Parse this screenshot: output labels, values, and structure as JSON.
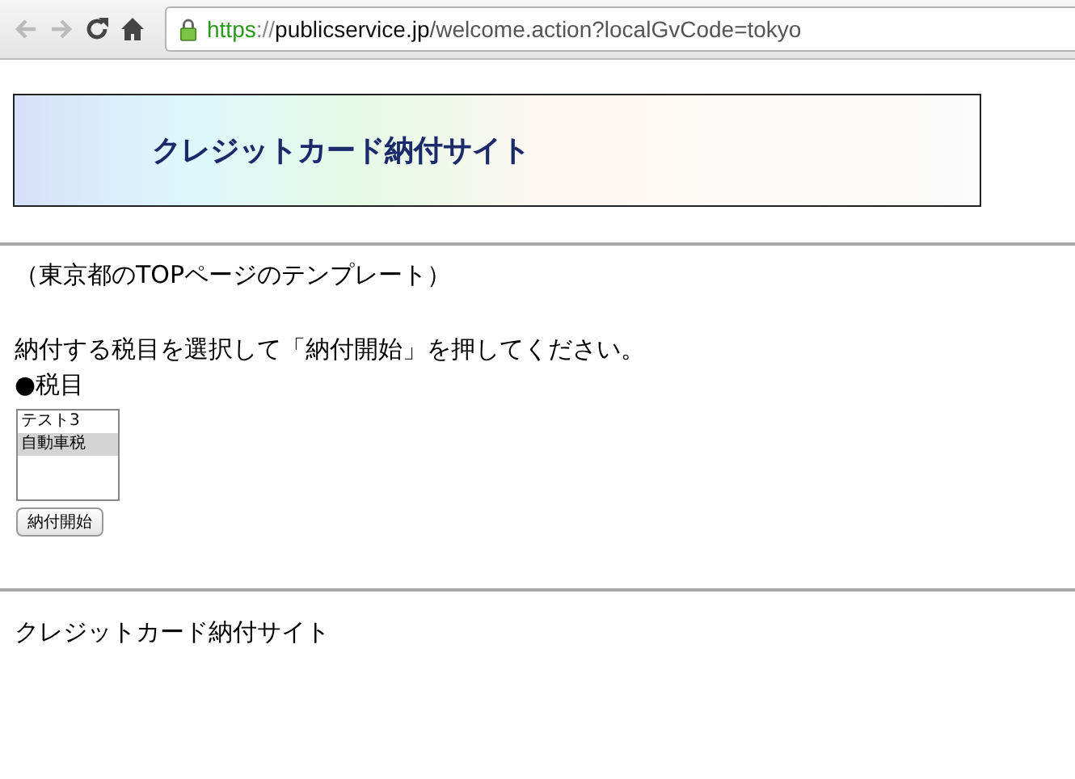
{
  "browser": {
    "back_disabled": true,
    "forward_disabled": true,
    "secure": true,
    "url_parts": [
      {
        "kind": "scheme",
        "text": "https"
      },
      {
        "kind": "separator",
        "text": "://"
      },
      {
        "kind": "host",
        "text": "publicservice.jp"
      },
      {
        "kind": "path",
        "text": "/welcome.action?localGvCode=tokyo"
      }
    ]
  },
  "banner": {
    "title": "クレジットカード納付サイト"
  },
  "template_note": "（東京都のTOPページのテンプレート）",
  "instruction": "納付する税目を選択して「納付開始」を押してください。",
  "section_label": "●税目",
  "tax_list": [
    {
      "label": "テスト3",
      "selected": false
    },
    {
      "label": "自動車税",
      "selected": true
    }
  ],
  "start_button": "納付開始",
  "footer": "クレジットカード納付サイト"
}
